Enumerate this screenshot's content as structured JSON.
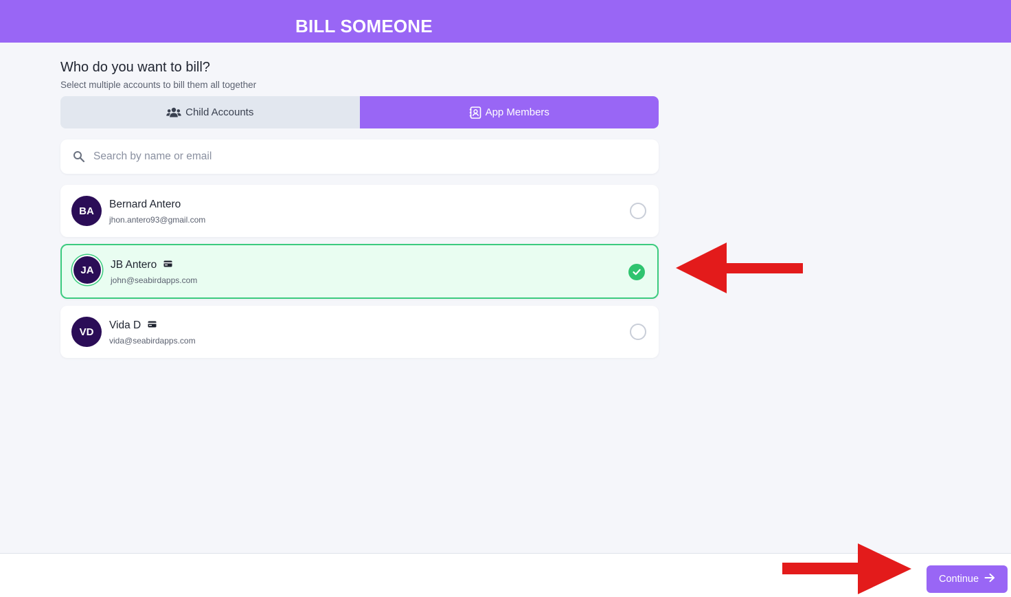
{
  "header": {
    "title": "BILL SOMEONE"
  },
  "prompt": {
    "heading": "Who do you want to bill?",
    "subheading": "Select multiple accounts to bill them all together"
  },
  "tabs": [
    {
      "label": "Child Accounts",
      "icon": "users-icon",
      "active": false
    },
    {
      "label": "App Members",
      "icon": "contact-card-icon",
      "active": true
    }
  ],
  "search": {
    "placeholder": "Search by name or email",
    "value": ""
  },
  "members": [
    {
      "initials": "BA",
      "name": "Bernard Antero",
      "email": "jhon.antero93@gmail.com",
      "has_card": false,
      "selected": false
    },
    {
      "initials": "JA",
      "name": "JB Antero",
      "email": "john@seabirdapps.com",
      "has_card": true,
      "selected": true
    },
    {
      "initials": "VD",
      "name": "Vida D",
      "email": "vida@seabirdapps.com",
      "has_card": true,
      "selected": false
    }
  ],
  "footer": {
    "continue_label": "Continue"
  },
  "colors": {
    "brand": "#9966f5",
    "avatar": "#2b0d57",
    "selected_bg": "#e9fdf1",
    "selected_border": "#3ccb7f",
    "annotation_arrow": "#e31b1b"
  }
}
